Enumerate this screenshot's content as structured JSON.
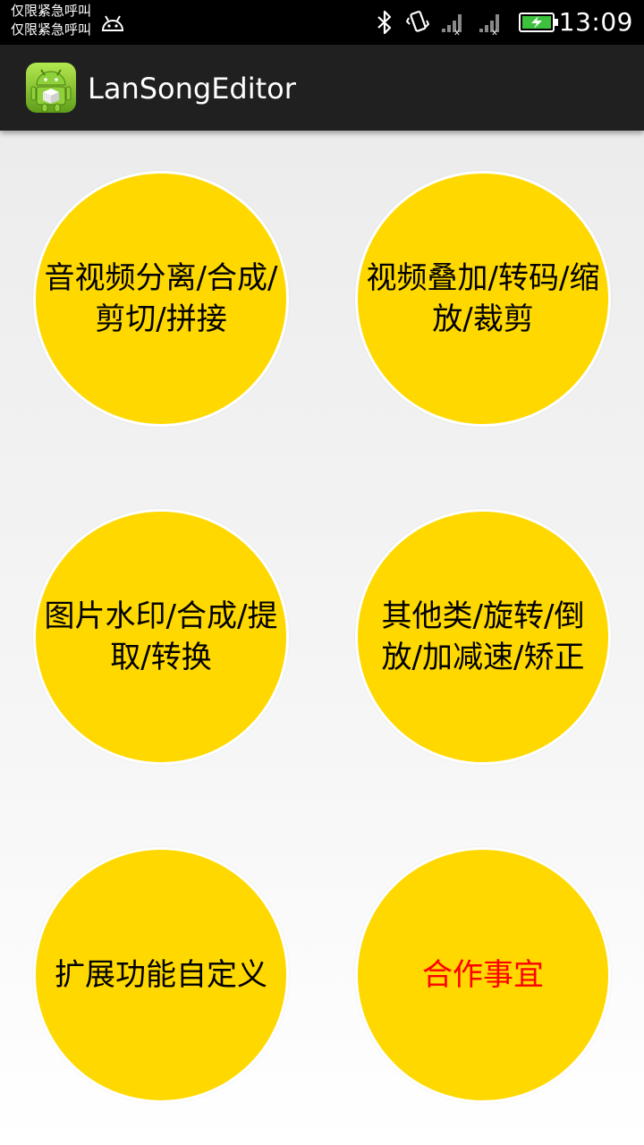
{
  "status_bar": {
    "carrier_line1": "仅限紧急呼叫",
    "carrier_line2": "仅限紧急呼叫",
    "time": "13:09",
    "icons": [
      "android-icon",
      "bluetooth-icon",
      "vibrate-icon",
      "signal-no-service-icon",
      "signal-no-service-icon",
      "battery-charging-icon"
    ]
  },
  "action_bar": {
    "title": "LanSongEditor",
    "icon": "android-app-icon"
  },
  "colors": {
    "circle_fill": "#ffd800",
    "circle_text": "#000000",
    "highlight_text": "#ff0000",
    "action_bar_bg": "#202020"
  },
  "buttons": [
    {
      "label": "音视频分离/合成/剪切/拼接"
    },
    {
      "label": "视频叠加/转码/缩放/裁剪"
    },
    {
      "label": "图片水印/合成/提取/转换"
    },
    {
      "label": "其他类/旋转/倒放/加减速/矫正"
    },
    {
      "label": "扩展功能自定义"
    },
    {
      "label": "合作事宜"
    }
  ]
}
